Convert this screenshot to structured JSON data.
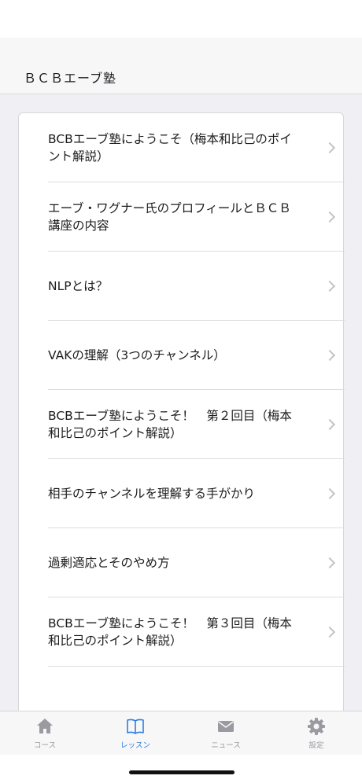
{
  "header": {
    "title": "ＢＣＢエーブ塾"
  },
  "lessons": [
    {
      "title": "BCBエーブ塾にようこそ（梅本和比己のポイント解説）"
    },
    {
      "title": "エーブ・ワグナー氏のプロフィールとＢＣＢ講座の内容"
    },
    {
      "title": "NLPとは？"
    },
    {
      "title": "VAKの理解（3つのチャンネル）"
    },
    {
      "title": "BCBエーブ塾にようこそ！　第２回目（梅本和比己のポイント解説）"
    },
    {
      "title": "相手のチャンネルを理解する手がかり"
    },
    {
      "title": "過剰適応とそのやめ方"
    },
    {
      "title": "BCBエーブ塾にようこそ！　第３回目（梅本和比己のポイント解説）"
    }
  ],
  "tabs": [
    {
      "label": "コース",
      "icon": "home-icon",
      "active": false
    },
    {
      "label": "レッスン",
      "icon": "book-icon",
      "active": true
    },
    {
      "label": "ニュース",
      "icon": "mail-icon",
      "active": false
    },
    {
      "label": "設定",
      "icon": "gear-icon",
      "active": false
    }
  ],
  "colors": {
    "accent": "#2d7fe0",
    "inactive": "#9a9aa0"
  }
}
